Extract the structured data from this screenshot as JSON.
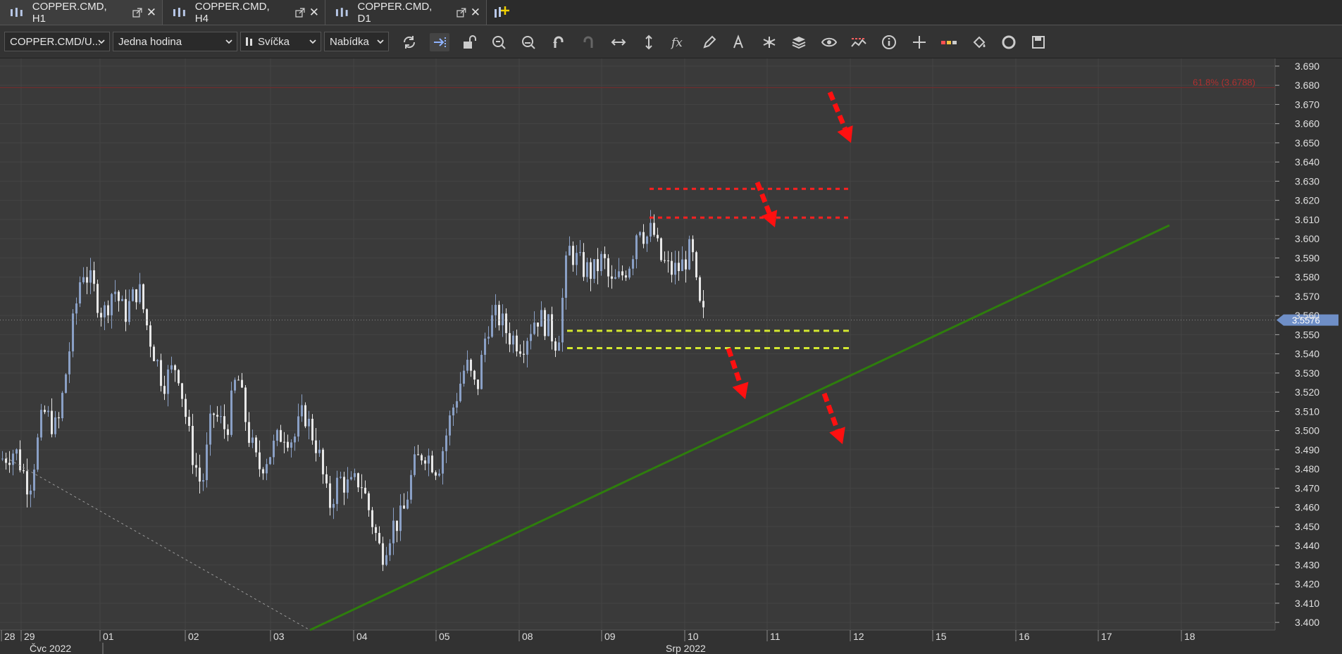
{
  "tabs": [
    {
      "label": "COPPER.CMD, H1",
      "active": true
    },
    {
      "label": "COPPER.CMD, H4",
      "active": false
    },
    {
      "label": "COPPER.CMD, D1",
      "active": false
    }
  ],
  "toolbar": {
    "instrument": "COPPER.CMD/U...",
    "period": "Jedna hodina",
    "chart_type": "Svíčka",
    "offer_side": "Nabídka",
    "tools": [
      "refresh-icon",
      "shift-chart-icon",
      "unlock-icon",
      "zoom-in-icon",
      "zoom-out-icon",
      "undo-icon",
      "redo-icon",
      "horizontal-scale-icon",
      "vertical-scale-icon",
      "indicators-fx-icon",
      "pencil-icon",
      "text-tool-icon",
      "pattern-icon",
      "layers-icon",
      "eye-icon",
      "alerts-icon",
      "info-icon",
      "crosshair-icon",
      "trade-levels-icon",
      "paint-bucket-icon",
      "theme-icon",
      "save-icon"
    ]
  },
  "chart_data": {
    "type": "candlestick",
    "price_axis": [
      "3.690",
      "3.680",
      "3.670",
      "3.660",
      "3.650",
      "3.640",
      "3.630",
      "3.620",
      "3.610",
      "3.600",
      "3.590",
      "3.580",
      "3.570",
      "3.560",
      "3.550",
      "3.540",
      "3.530",
      "3.520",
      "3.510",
      "3.500",
      "3.490",
      "3.480",
      "3.470",
      "3.460",
      "3.450",
      "3.440",
      "3.430",
      "3.420",
      "3.410",
      "3.400"
    ],
    "ylim": [
      3.396,
      3.694
    ],
    "time_axis": [
      "28",
      "29",
      "01",
      "02",
      "03",
      "04",
      "05",
      "08",
      "09",
      "10",
      "11",
      "12",
      "15",
      "16",
      "17",
      "18"
    ],
    "month_labels": [
      "Čvc 2022",
      "Srp 2022"
    ],
    "current_price": "3.5576",
    "fib_label": "61.8% (3.6788)",
    "colors": {
      "bull": "#8aa0c6",
      "bear": "#e8e8e8",
      "trend": "#2e7d0d",
      "resistance": "#ff2020",
      "support": "#d4e830",
      "arrow": "#ff1010"
    },
    "resistance_levels": [
      3.626,
      3.611
    ],
    "support_levels": [
      3.552,
      3.543
    ],
    "trendline": {
      "from_price": 3.396,
      "to_price": 3.607
    }
  }
}
